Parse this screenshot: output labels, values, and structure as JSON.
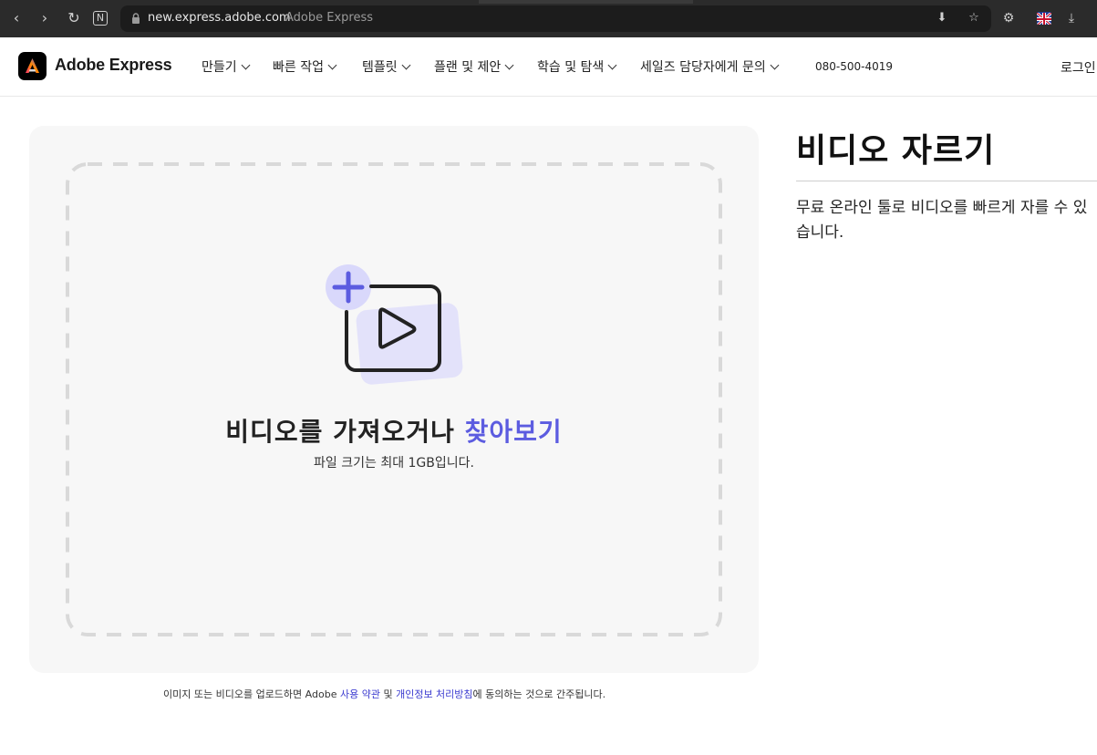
{
  "browser": {
    "url_domain": "new.express.adobe.com",
    "url_title": "Adobe Express"
  },
  "header": {
    "logo_text": "Adobe Express",
    "nav": [
      "만들기",
      "빠른 작업",
      "템플릿",
      "플랜 및 제안",
      "학습 및 탐색",
      "세일즈 담당자에게 문의"
    ],
    "phone": "080-500-4019",
    "login": "로그인"
  },
  "dropzone": {
    "title_main": "비디오를 가져오거나 ",
    "title_link": "찾아보기",
    "subtitle": "파일 크기는 최대 1GB입니다."
  },
  "terms": {
    "prefix": "이미지 또는 비디오를 업로드하면 Adobe ",
    "link1": "사용 약관",
    "middle": " 및 ",
    "link2": "개인정보 처리방침",
    "suffix": "에 동의하는 것으로 간주됩니다."
  },
  "side": {
    "title": "비디오 자르기",
    "description": "무료 온라인 툴로 비디오를 빠르게 자를 수 있습니다."
  },
  "colors": {
    "accent": "#5c5ce0",
    "dropzone_bg": "#f7f7f7",
    "dash": "#d9d9d9"
  }
}
